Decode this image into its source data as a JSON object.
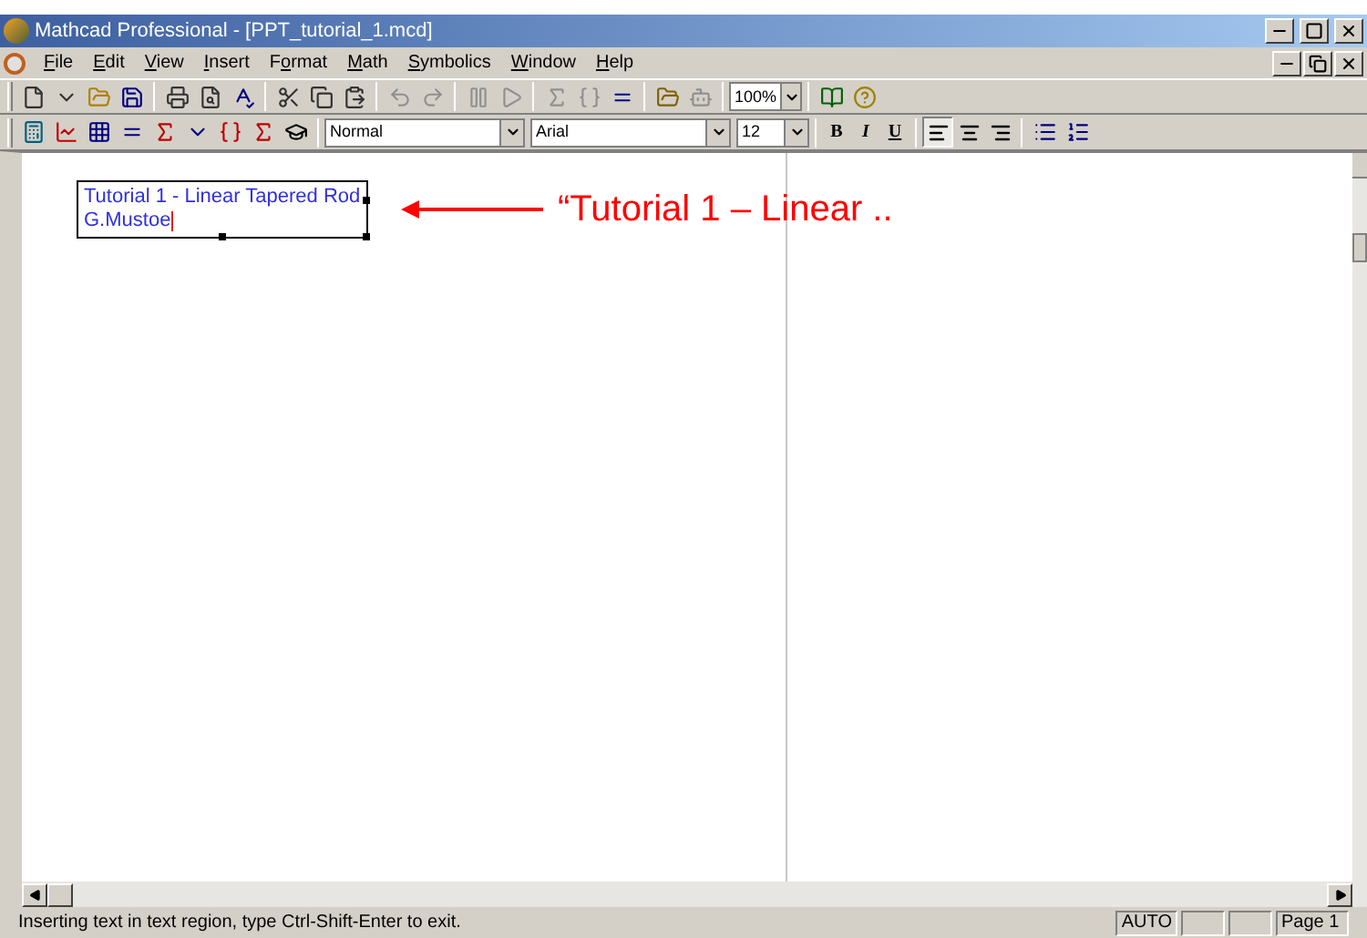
{
  "window": {
    "title": "Mathcad Professional - [PPT_tutorial_1.mcd]"
  },
  "menu": [
    {
      "key": "F",
      "after": "ile"
    },
    {
      "key": "E",
      "after": "dit"
    },
    {
      "key": "V",
      "after": "iew"
    },
    {
      "key": "I",
      "after": "nsert"
    },
    {
      "before": "F",
      "key": "o",
      "after": "rmat"
    },
    {
      "key": "M",
      "after": "ath"
    },
    {
      "key": "S",
      "after": "ymbolics"
    },
    {
      "key": "W",
      "after": "indow"
    },
    {
      "key": "H",
      "after": "elp"
    }
  ],
  "toolbar": {
    "zoom": "100%"
  },
  "format_bar": {
    "style": "Normal",
    "font": "Arial",
    "size": "12",
    "bold": "B",
    "italic": "I",
    "underline": "U",
    "alignment": [
      {
        "kind": "left",
        "selected": true
      },
      {
        "kind": "center",
        "selected": false
      },
      {
        "kind": "right",
        "selected": false
      }
    ]
  },
  "document": {
    "text_region": {
      "lines": [
        "Tutorial 1 - Linear Tapered Rod",
        "G.Mustoe"
      ]
    },
    "annotation": "“Tutorial 1 – Linear .."
  },
  "status_bar": {
    "message": "Inserting text in text region, type Ctrl-Shift-Enter to exit.",
    "mode": "AUTO",
    "page": "Page 1"
  }
}
